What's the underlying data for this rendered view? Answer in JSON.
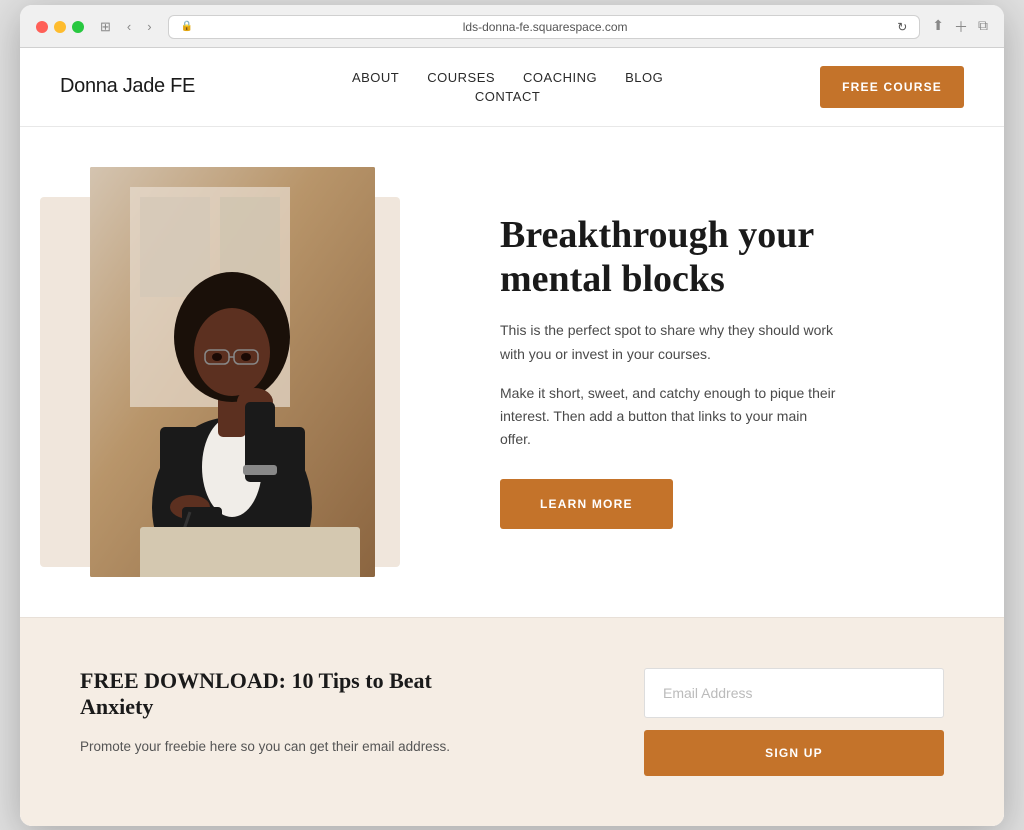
{
  "browser": {
    "url": "lds-donna-fe.squarespace.com",
    "reload_icon": "↻"
  },
  "header": {
    "logo": "Donna Jade FE",
    "nav": {
      "about": "ABOUT",
      "courses": "COURSES",
      "coaching": "COACHING",
      "blog": "BLOG",
      "contact": "CONTACT"
    },
    "free_course_btn": "FREE COURSE"
  },
  "hero": {
    "title": "Breakthrough your mental blocks",
    "description1": "This is the perfect spot to share why they should work with you or invest in your courses.",
    "description2": "Make it short, sweet, and catchy enough to pique their interest. Then add a button that links to your main offer.",
    "learn_more_btn": "LEARN MORE"
  },
  "free_download": {
    "title": "FREE DOWNLOAD: 10 Tips to Beat Anxiety",
    "description": "Promote your freebie here so you can get their email address.",
    "email_placeholder": "Email Address",
    "sign_up_btn": "SIGN UP"
  },
  "colors": {
    "accent": "#c4732a",
    "bg_light": "#f5ede4",
    "image_bg": "#f0e6dc"
  }
}
